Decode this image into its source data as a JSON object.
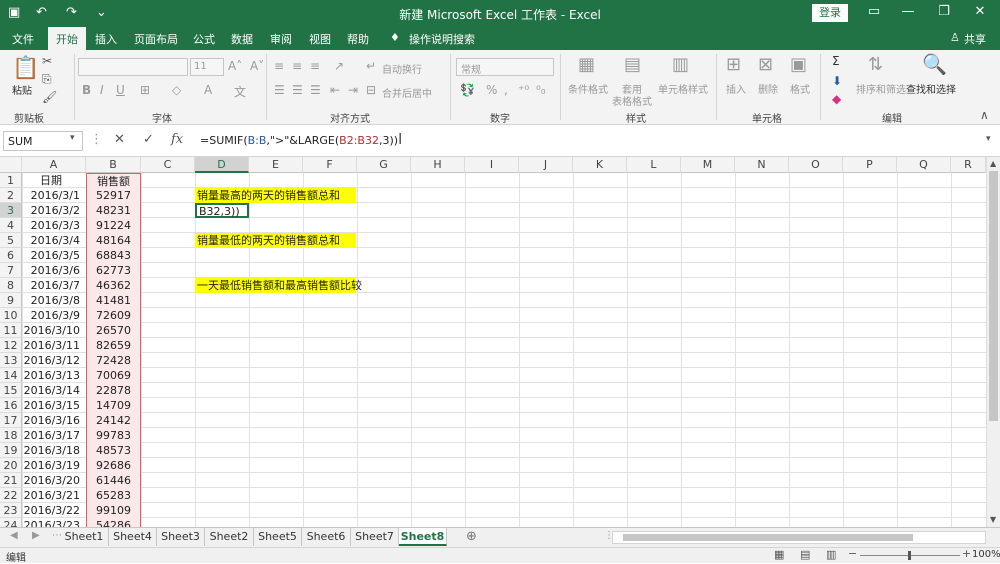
{
  "titlebar": {
    "title": "新建 Microsoft Excel 工作表 - Excel",
    "login": "登录",
    "undo": "↶",
    "redo": "↷",
    "customize": "⌄"
  },
  "menu": {
    "tabs": [
      "文件",
      "开始",
      "插入",
      "页面布局",
      "公式",
      "数据",
      "审阅",
      "视图",
      "帮助"
    ],
    "tell": "操作说明搜索",
    "share": "共享"
  },
  "ribbon": {
    "paste": "粘贴",
    "clipboard": "剪贴板",
    "font_group": "字体",
    "font_size": "11",
    "align_group": "对齐方式",
    "wrap": "自动换行",
    "merge": "合并后居中",
    "number_group": "数字",
    "number_format": "常规",
    "styles_group": "样式",
    "cond_format": "条件格式",
    "table_format": "套用\n表格格式",
    "cell_style": "单元格样式",
    "cells_group": "单元格",
    "insert": "插入",
    "delete": "删除",
    "format": "格式",
    "edit_group": "编辑",
    "sort": "排序和筛选",
    "find": "查找和选择"
  },
  "formula_bar": {
    "name_box": "SUM",
    "formula_parts": [
      "=SUMIF(",
      "B:B",
      ",\">\"&LARGE(",
      "B2:B32",
      ",3))"
    ]
  },
  "columns": [
    "A",
    "B",
    "C",
    "D",
    "E",
    "F",
    "G",
    "H",
    "I",
    "J",
    "K",
    "L",
    "M",
    "N",
    "O",
    "P",
    "Q",
    "R"
  ],
  "rows": [
    {
      "n": "1",
      "a": "日期",
      "b": "销售额"
    },
    {
      "n": "2",
      "a": "2016/3/1",
      "b": "52917"
    },
    {
      "n": "3",
      "a": "2016/3/2",
      "b": "48231"
    },
    {
      "n": "4",
      "a": "2016/3/3",
      "b": "91224"
    },
    {
      "n": "5",
      "a": "2016/3/4",
      "b": "48164"
    },
    {
      "n": "6",
      "a": "2016/3/5",
      "b": "68843"
    },
    {
      "n": "7",
      "a": "2016/3/6",
      "b": "62773"
    },
    {
      "n": "8",
      "a": "2016/3/7",
      "b": "46362"
    },
    {
      "n": "9",
      "a": "2016/3/8",
      "b": "41481"
    },
    {
      "n": "10",
      "a": "2016/3/9",
      "b": "72609"
    },
    {
      "n": "11",
      "a": "2016/3/10",
      "b": "26570"
    },
    {
      "n": "12",
      "a": "2016/3/11",
      "b": "82659"
    },
    {
      "n": "13",
      "a": "2016/3/12",
      "b": "72428"
    },
    {
      "n": "14",
      "a": "2016/3/13",
      "b": "70069"
    },
    {
      "n": "15",
      "a": "2016/3/14",
      "b": "22878"
    },
    {
      "n": "16",
      "a": "2016/3/15",
      "b": "14709"
    },
    {
      "n": "17",
      "a": "2016/3/16",
      "b": "24142"
    },
    {
      "n": "18",
      "a": "2016/3/17",
      "b": "99783"
    },
    {
      "n": "19",
      "a": "2016/3/18",
      "b": "48573"
    },
    {
      "n": "20",
      "a": "2016/3/19",
      "b": "92686"
    },
    {
      "n": "21",
      "a": "2016/3/20",
      "b": "61446"
    },
    {
      "n": "22",
      "a": "2016/3/21",
      "b": "65283"
    },
    {
      "n": "23",
      "a": "2016/3/22",
      "b": "99109"
    },
    {
      "n": "24",
      "a": "2016/3/23",
      "b": "54286"
    }
  ],
  "notes": {
    "d2": "销量最高的两天的销售额总和",
    "d3": "B32,3))",
    "d5": "销量最低的两天的销售额总和",
    "d8": "一天最低销售额和最高销售额比较"
  },
  "sheets": [
    "Sheet1",
    "Sheet4",
    "Sheet3",
    "Sheet2",
    "Sheet5",
    "Sheet6",
    "Sheet7",
    "Sheet8"
  ],
  "status": {
    "mode": "编辑",
    "zoom": "100%"
  },
  "colors": {
    "excel_green": "#217346",
    "highlight": "#ffff00"
  }
}
